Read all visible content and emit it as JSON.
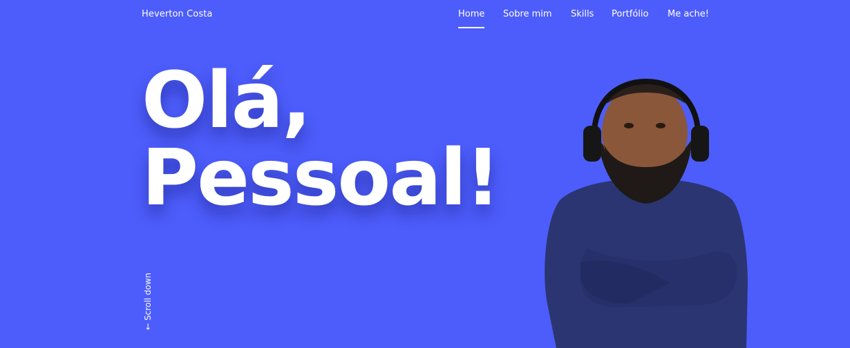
{
  "header": {
    "brand": "Heverton Costa",
    "nav": [
      {
        "label": "Home",
        "active": true
      },
      {
        "label": "Sobre mim",
        "active": false
      },
      {
        "label": "Skills",
        "active": false
      },
      {
        "label": "Portfólio",
        "active": false
      },
      {
        "label": "Me ache!",
        "active": false
      }
    ]
  },
  "hero": {
    "headline_line1": "Olá,",
    "headline_line2": "Pessoal!",
    "scroll_label": "← Scroll down"
  },
  "colors": {
    "background": "#4d5dfb",
    "text": "#ffffff",
    "sweater": "#2b3572"
  }
}
